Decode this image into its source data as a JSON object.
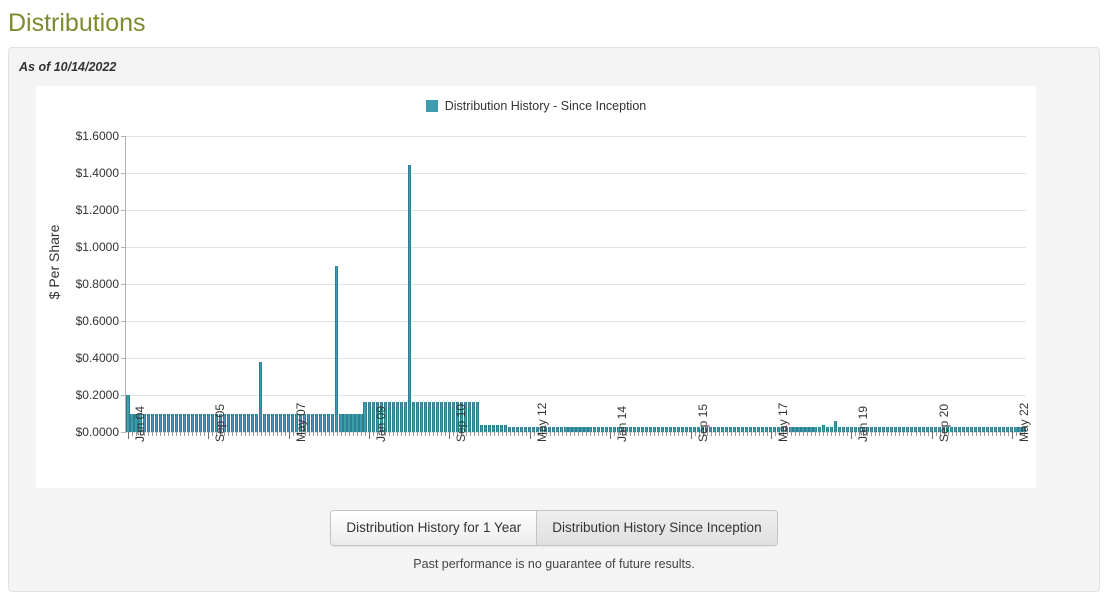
{
  "page": {
    "title": "Distributions",
    "title_color": "#7a8c2e",
    "as_of": "As of 10/14/2022",
    "disclaimer": "Past performance is no guarantee of future results."
  },
  "buttons": [
    {
      "label": "Distribution History for 1 Year",
      "active": false
    },
    {
      "label": "Distribution History Since Inception",
      "active": true
    }
  ],
  "chart_data": {
    "type": "bar",
    "title": "",
    "legend": [
      "Distribution History - Since Inception"
    ],
    "legend_position": "top-center",
    "series_color": "#3e9bab",
    "xlabel": "",
    "ylabel": "$ Per Share",
    "ylim": [
      0,
      1.6
    ],
    "ytick_labels": [
      "$0.0000",
      "$0.2000",
      "$0.4000",
      "$0.6000",
      "$0.8000",
      "$1.0000",
      "$1.2000",
      "$1.4000",
      "$1.6000"
    ],
    "ytick_values": [
      0,
      0.2,
      0.4,
      0.6,
      0.8,
      1.0,
      1.2,
      1.4,
      1.6
    ],
    "grid": true,
    "xtick_labels": [
      "Jan 04",
      "Sep 05",
      "May 07",
      "Jan 09",
      "Sep 10",
      "May 12",
      "Jan 14",
      "Sep 15",
      "May 17",
      "Jan 19",
      "Sep 20",
      "May 22"
    ],
    "xtick_indices": [
      0,
      20,
      40,
      60,
      80,
      100,
      120,
      140,
      160,
      180,
      200,
      220
    ],
    "x_start": "Jan 04",
    "x_interval": "monthly",
    "values": [
      0.2,
      0.1,
      0.1,
      0.1,
      0.1,
      0.1,
      0.1,
      0.1,
      0.1,
      0.1,
      0.1,
      0.1,
      0.1,
      0.1,
      0.1,
      0.1,
      0.1,
      0.1,
      0.1,
      0.1,
      0.1,
      0.1,
      0.1,
      0.1,
      0.1,
      0.1,
      0.1,
      0.1,
      0.1,
      0.1,
      0.1,
      0.1,
      0.1,
      0.38,
      0.1,
      0.1,
      0.1,
      0.1,
      0.1,
      0.1,
      0.1,
      0.1,
      0.1,
      0.1,
      0.1,
      0.1,
      0.1,
      0.1,
      0.1,
      0.1,
      0.1,
      0.1,
      0.895,
      0.1,
      0.1,
      0.1,
      0.1,
      0.1,
      0.1,
      0.16,
      0.16,
      0.16,
      0.16,
      0.16,
      0.16,
      0.16,
      0.16,
      0.16,
      0.16,
      0.16,
      1.445,
      0.16,
      0.16,
      0.16,
      0.16,
      0.16,
      0.16,
      0.16,
      0.16,
      0.16,
      0.16,
      0.16,
      0.16,
      0.16,
      0.16,
      0.16,
      0.16,
      0.16,
      0.04,
      0.04,
      0.04,
      0.04,
      0.04,
      0.04,
      0.04,
      0.025,
      0.025,
      0.025,
      0.025,
      0.025,
      0.025,
      0.025,
      0.025,
      0.025,
      0.025,
      0.025,
      0.025,
      0.025,
      0.025,
      0.025,
      0.025,
      0.025,
      0.025,
      0.025,
      0.025,
      0.025,
      0.025,
      0.025,
      0.025,
      0.025,
      0.025,
      0.025,
      0.025,
      0.025,
      0.025,
      0.025,
      0.025,
      0.025,
      0.025,
      0.025,
      0.025,
      0.025,
      0.025,
      0.025,
      0.025,
      0.025,
      0.025,
      0.025,
      0.025,
      0.025,
      0.025,
      0.025,
      0.025,
      0.025,
      0.025,
      0.025,
      0.025,
      0.025,
      0.025,
      0.025,
      0.025,
      0.025,
      0.025,
      0.025,
      0.025,
      0.025,
      0.025,
      0.025,
      0.025,
      0.025,
      0.025,
      0.025,
      0.025,
      0.025,
      0.025,
      0.025,
      0.025,
      0.025,
      0.025,
      0.025,
      0.025,
      0.025,
      0.025,
      0.04,
      0.025,
      0.025,
      0.06,
      0.025,
      0.025,
      0.025,
      0.025,
      0.025,
      0.025,
      0.025,
      0.025,
      0.025,
      0.025,
      0.025,
      0.025,
      0.025,
      0.025,
      0.025,
      0.025,
      0.025,
      0.025,
      0.025,
      0.025,
      0.025,
      0.025,
      0.025,
      0.025,
      0.025,
      0.025,
      0.025,
      0.025,
      0.025,
      0.025,
      0.025,
      0.025,
      0.025,
      0.025,
      0.025,
      0.025,
      0.025,
      0.025,
      0.025,
      0.025,
      0.025,
      0.025,
      0.025,
      0.025,
      0.025,
      0.025,
      0.025
    ]
  }
}
